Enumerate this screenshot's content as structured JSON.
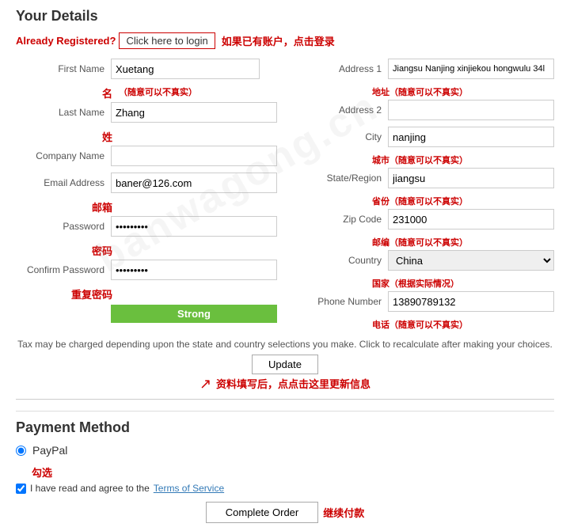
{
  "page": {
    "title": "Your Details",
    "already_registered_label": "Already Registered?",
    "login_btn_label": "Click here to login",
    "cn_login_note": "如果已有账户，点击登录"
  },
  "form_left": {
    "first_name_label": "First Name",
    "first_name_value": "Xuetang",
    "first_name_cn": "名",
    "first_name_note": "（随意可以不真实）",
    "last_name_label": "Last Name",
    "last_name_value": "Zhang",
    "last_name_cn": "姓",
    "company_name_label": "Company Name",
    "company_name_value": "",
    "email_label": "Email Address",
    "email_value": "baner@126.com",
    "email_cn": "邮箱",
    "password_label": "Password",
    "password_value": "••••••••",
    "password_cn": "密码",
    "confirm_password_label": "Confirm Password",
    "confirm_password_value": "••••••••",
    "confirm_password_cn": "重复密码",
    "strength_label": "Strong"
  },
  "form_right": {
    "address1_label": "Address 1",
    "address1_value": "Jiangsu Nanjing xinjiekou hongwulu 34l",
    "address1_cn": "地址（随意可以不真实）",
    "address2_label": "Address 2",
    "address2_value": "",
    "city_label": "City",
    "city_value": "nanjing",
    "city_cn": "城市（随意可以不真实）",
    "state_label": "State/Region",
    "state_value": "jiangsu",
    "state_cn": "省份（随意可以不真实）",
    "zip_label": "Zip Code",
    "zip_value": "231000",
    "zip_cn": "邮编（随意可以不真实）",
    "country_label": "Country",
    "country_value": "China",
    "country_cn": "国家（根据实际情况）",
    "phone_label": "Phone Number",
    "phone_value": "13890789132",
    "phone_cn": "电话（随意可以不真实）"
  },
  "tax_notice": "Tax may be charged depending upon the state and country selections you make. Click to recalculate after making your choices.",
  "update_btn_label": "Update",
  "update_cn": "资料填写后，点点击这里更新信息",
  "payment": {
    "title": "Payment Method",
    "paypal_label": "PayPal",
    "terms_prefix": "I have read and agree to the",
    "terms_link": "Terms of Service",
    "complete_btn_label": "Complete Order",
    "complete_cn": "继续付款",
    "check_cn": "勾选"
  },
  "watermark": "banwagong.cn"
}
